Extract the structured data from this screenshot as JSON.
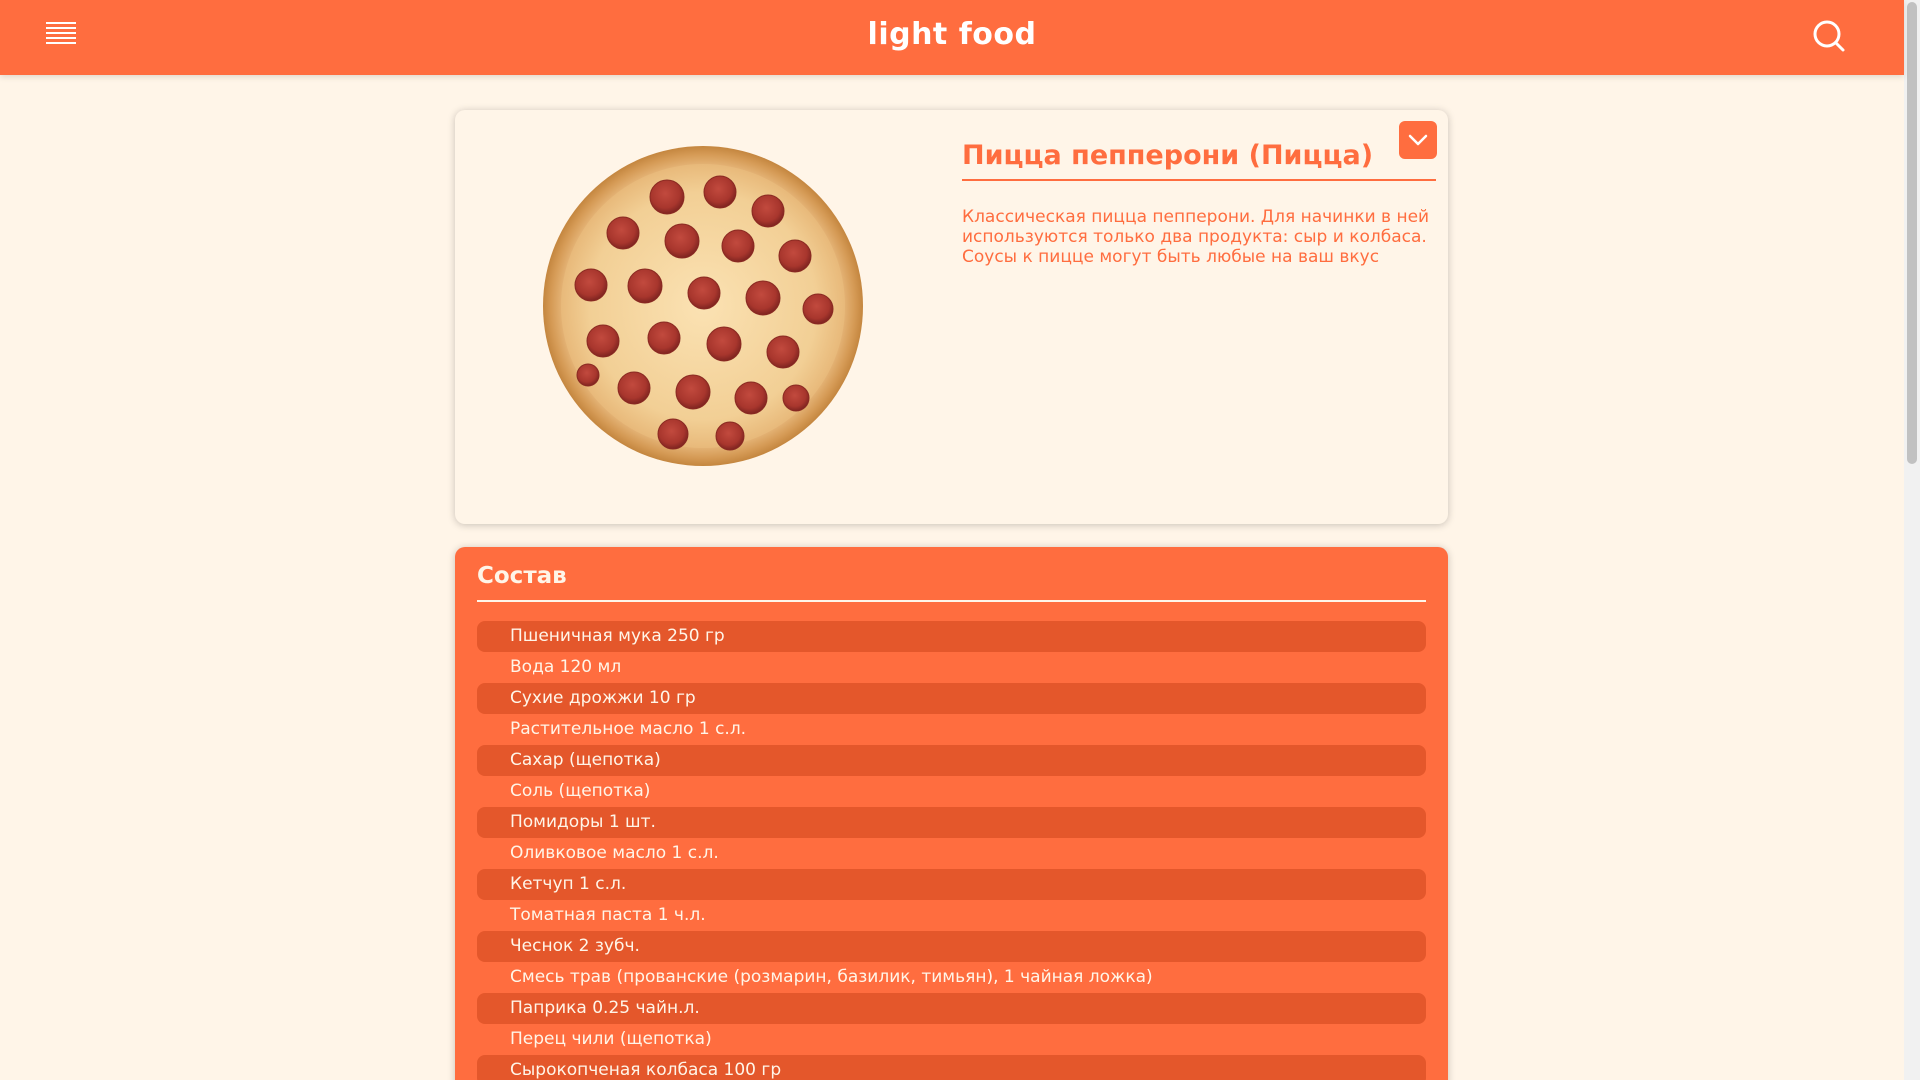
{
  "header": {
    "logo": "light food",
    "menu_icon": "hamburger-menu-icon",
    "search_icon": "search-icon",
    "background": "#ff6d3f"
  },
  "recipe": {
    "title": "Пицца пепперони (Пицца)",
    "description": "Классическая пицца пепперони. Для начинки в ней используются только два продукта: сыр и колбаса. Соусы к пицце могут быть любые на ваш вкус",
    "image": "pepperoni-pizza-image",
    "collapse_icon": "chevron-down-icon"
  },
  "ingredients": {
    "title": "Состав",
    "items": [
      "Пшеничная мука 250 гр",
      "Вода 120 мл",
      "Сухие дрожжи 10 гр",
      "Растительное масло 1 с.л.",
      "Сахар (щепотка)",
      "Соль (щепотка)",
      "Помидоры 1 шт.",
      "Оливковое масло 1 с.л.",
      "Кетчуп 1 с.л.",
      "Томатная паста 1 ч.л.",
      "Чеснок 2 зубч.",
      "Смесь трав (прованские (розмарин, базилик, тимьян), 1 чайная ложка)",
      "Паприка 0.25 чайн.л.",
      "Перец чили (щепотка)",
      "Сырокопченая колбаса 100 гр"
    ]
  },
  "colors": {
    "accent": "#ff6d3f",
    "accent_dark": "#e4572b",
    "background": "#fff5e8"
  }
}
